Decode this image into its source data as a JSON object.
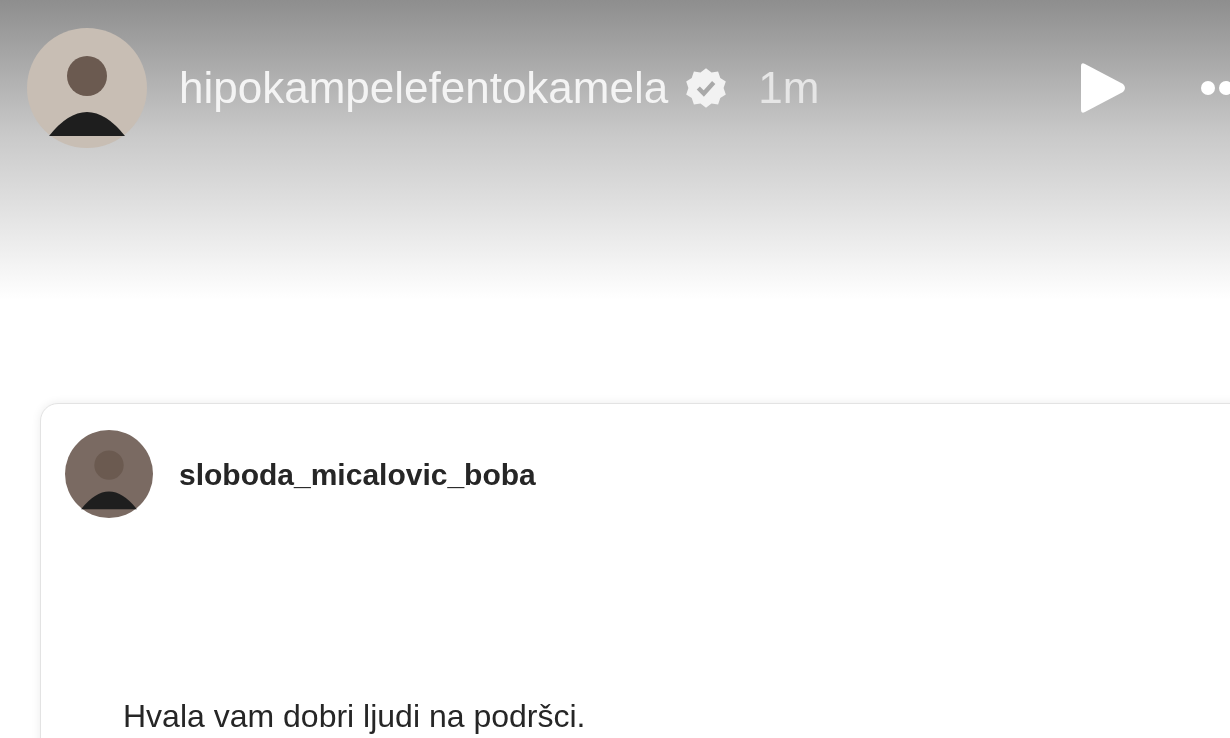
{
  "story_header": {
    "username": "hipokampelefentokamela",
    "verified": true,
    "time": "1m"
  },
  "shared_post": {
    "username": "sloboda_micalovic_boba",
    "text": "Hvala vam dobri ljudi na podršci."
  }
}
